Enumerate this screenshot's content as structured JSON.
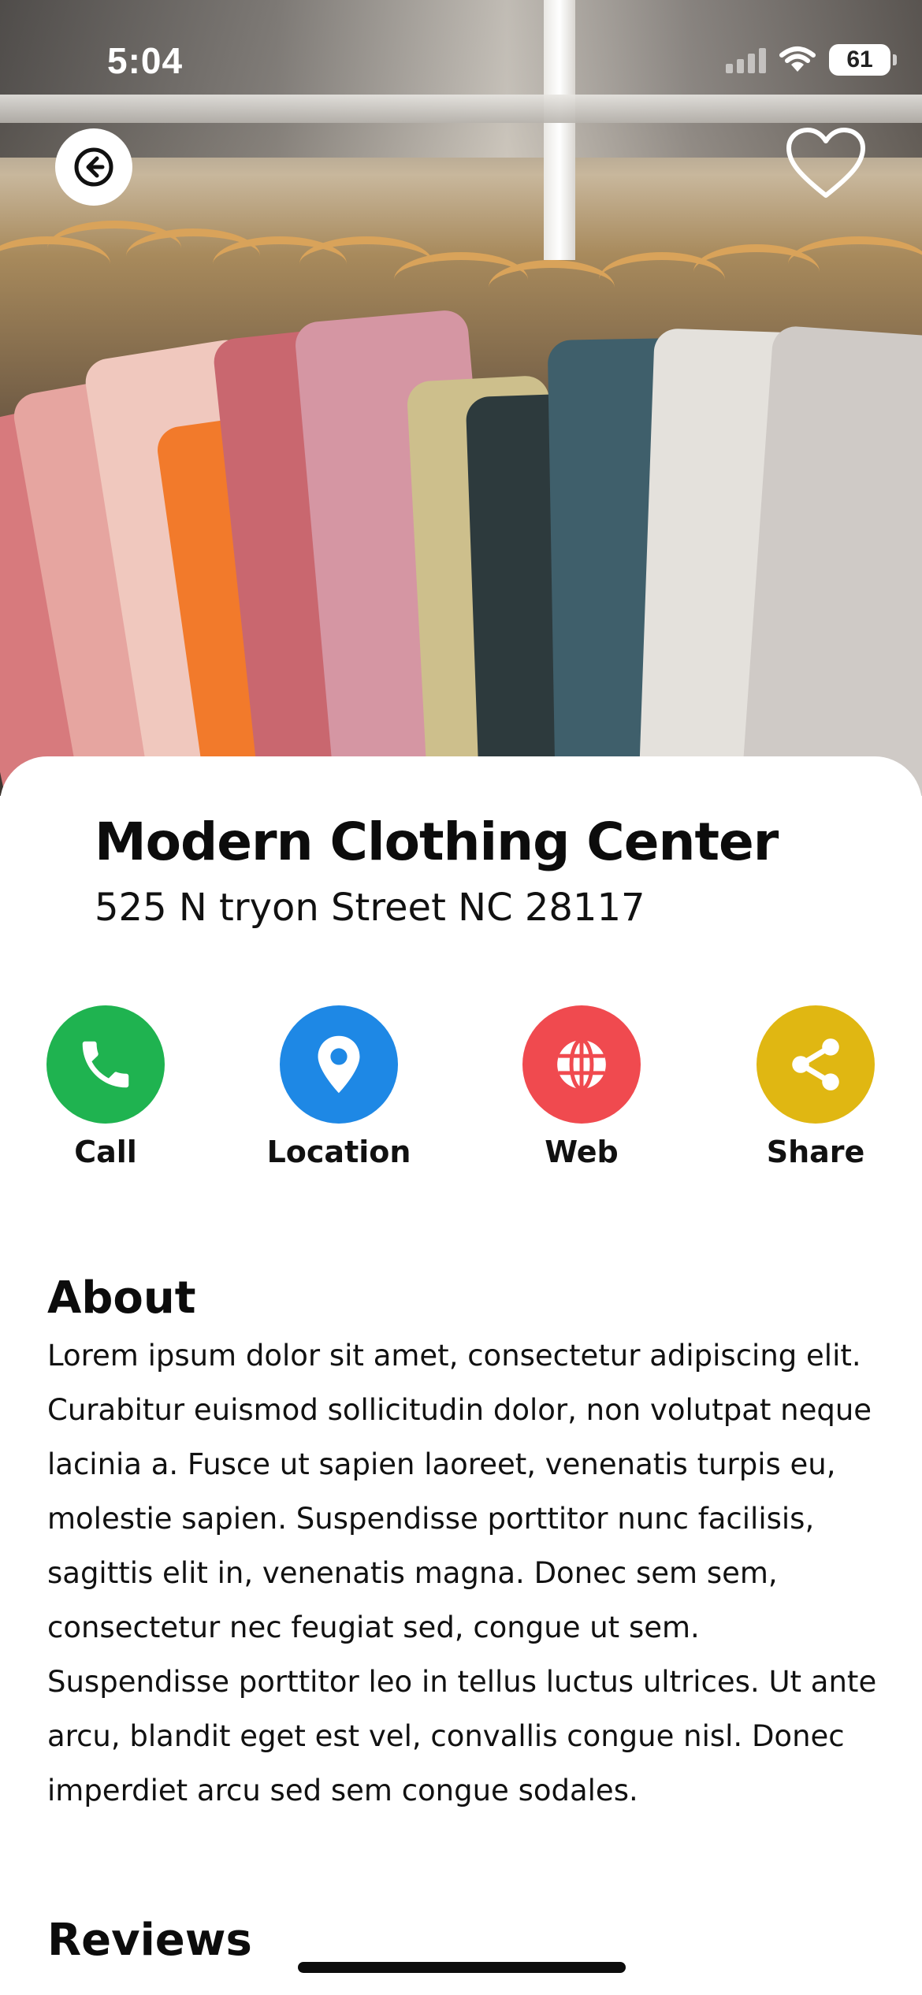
{
  "status_bar": {
    "time": "5:04",
    "battery": "61"
  },
  "header": {
    "back_icon": "arrow-left-icon",
    "favorite_icon": "heart-outline-icon"
  },
  "store": {
    "name": "Modern Clothing Center",
    "address": "525 N tryon Street NC 28117"
  },
  "actions": [
    {
      "label": "Call",
      "icon": "phone-icon",
      "color": "#1fb350"
    },
    {
      "label": "Location",
      "icon": "map-pin-icon",
      "color": "#1e88e5"
    },
    {
      "label": "Web",
      "icon": "globe-icon",
      "color": "#f04a4f"
    },
    {
      "label": "Share",
      "icon": "share-icon",
      "color": "#e0b712"
    }
  ],
  "about": {
    "heading": "About",
    "text": "Lorem ipsum dolor sit amet, consectetur adipiscing elit. Curabitur euismod sollicitudin dolor, non volutpat neque lacinia a. Fusce ut sapien laoreet, venenatis turpis eu, molestie sapien. Suspendisse porttitor nunc facilisis, sagittis elit in, venenatis magna. Donec sem sem, consectetur nec feugiat sed, congue ut sem. Suspendisse porttitor leo in tellus luctus ultrices. Ut ante arcu, blandit eget est vel, convallis congue nisl. Donec imperdiet arcu sed sem congue sodales."
  },
  "reviews": {
    "heading": "Reviews"
  }
}
